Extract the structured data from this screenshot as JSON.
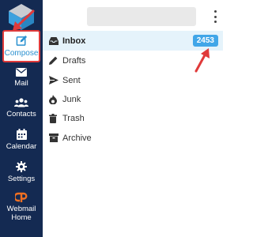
{
  "sidebar": {
    "compose": {
      "label": "Compose",
      "icon": "compose-icon"
    },
    "items": [
      {
        "label": "Mail",
        "icon": "envelope-icon"
      },
      {
        "label": "Contacts",
        "icon": "contacts-icon"
      },
      {
        "label": "Calendar",
        "icon": "calendar-icon"
      },
      {
        "label": "Settings",
        "icon": "gear-icon"
      },
      {
        "label": "Webmail Home",
        "icon": "cpanel-icon"
      }
    ]
  },
  "folders": [
    {
      "label": "Inbox",
      "icon": "inbox-icon",
      "badge": "2453",
      "active": true
    },
    {
      "label": "Drafts",
      "icon": "pencil-icon"
    },
    {
      "label": "Sent",
      "icon": "send-icon"
    },
    {
      "label": "Junk",
      "icon": "fire-icon"
    },
    {
      "label": "Trash",
      "icon": "trash-icon"
    },
    {
      "label": "Archive",
      "icon": "archive-icon"
    }
  ],
  "colors": {
    "sidebar_bg": "#142a52",
    "accent": "#2b91d0",
    "badge_bg": "#41a6e8",
    "active_row_bg": "#e5f3fb",
    "annotation_red": "#e03a3a"
  }
}
